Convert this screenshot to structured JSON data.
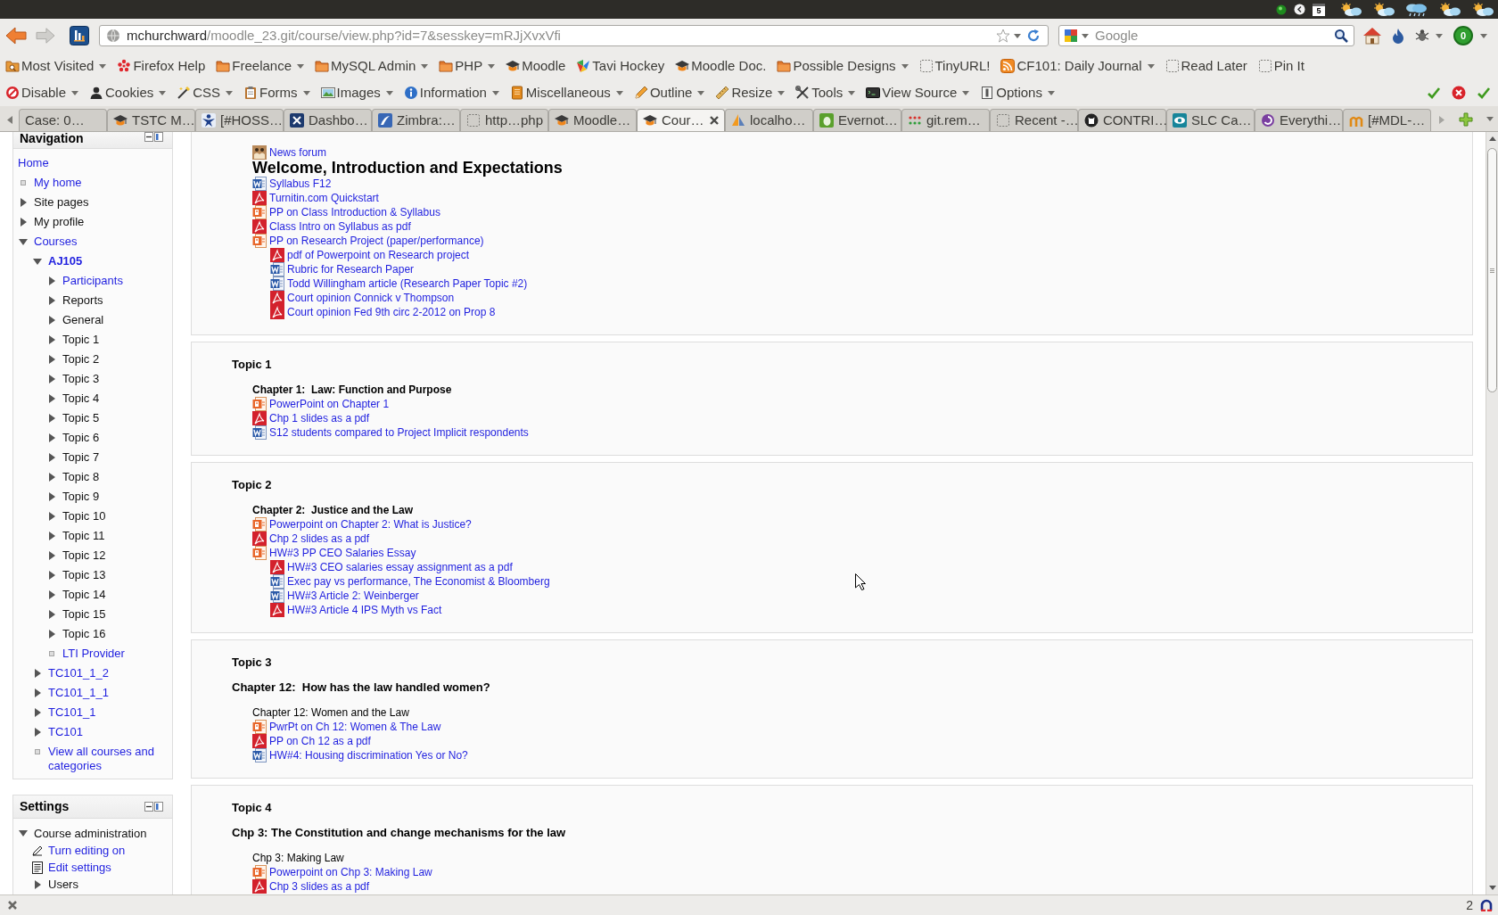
{
  "panel": {
    "calendar_day": "5"
  },
  "navbar": {
    "url_host": "mchurchward",
    "url_path": "/moodle_23.git/course/view.php?id=7&sesskey=mRJjXvxVfi",
    "search": {
      "placeholder": "Google"
    },
    "badge": "0"
  },
  "bookmarks": [
    {
      "label": "Most Visited",
      "kind": "smart",
      "menu": true
    },
    {
      "label": "Firefox Help",
      "kind": "help",
      "menu": false
    },
    {
      "label": "Freelance",
      "kind": "folder",
      "menu": true
    },
    {
      "label": "MySQL Admin",
      "kind": "folder",
      "menu": true
    },
    {
      "label": "PHP",
      "kind": "folder",
      "menu": true
    },
    {
      "label": "Moodle",
      "kind": "moodle",
      "menu": false
    },
    {
      "label": "Tavi Hockey",
      "kind": "site",
      "menu": false
    },
    {
      "label": "Moodle Doc.",
      "kind": "moodle",
      "menu": false
    },
    {
      "label": "Possible Designs",
      "kind": "folder",
      "menu": true
    },
    {
      "label": "TinyURL!",
      "kind": "page",
      "menu": false
    },
    {
      "label": "CF101: Daily Journal",
      "kind": "feed",
      "menu": true
    },
    {
      "label": "Read Later",
      "kind": "page",
      "menu": false
    },
    {
      "label": "Pin It",
      "kind": "page",
      "menu": false
    }
  ],
  "developer_toolbar": [
    "Disable",
    "Cookies",
    "CSS",
    "Forms",
    "Images",
    "Information",
    "Miscellaneous",
    "Outline",
    "Resize",
    "Tools",
    "View Source",
    "Options"
  ],
  "tabs": [
    {
      "label": "Case: 0…",
      "selected": false
    },
    {
      "label": "TSTC M…",
      "selected": false
    },
    {
      "label": "[#HOSS…",
      "selected": false
    },
    {
      "label": "Dashbo…",
      "selected": false
    },
    {
      "label": "Zimbra:…",
      "selected": false
    },
    {
      "label": "http…php",
      "selected": false
    },
    {
      "label": "Moodle…",
      "selected": false
    },
    {
      "label": "Cour…",
      "selected": true
    },
    {
      "label": "localho…",
      "selected": false
    },
    {
      "label": "Evernot…",
      "selected": false
    },
    {
      "label": "git.rem…",
      "selected": false
    },
    {
      "label": "Recent -…",
      "selected": false
    },
    {
      "label": "CONTRI…",
      "selected": false
    },
    {
      "label": "SLC Ca…",
      "selected": false
    },
    {
      "label": "Everythi…",
      "selected": false
    },
    {
      "label": "[#MDL-…",
      "selected": false
    }
  ],
  "navigation": {
    "title": "Navigation",
    "items": [
      {
        "label": "Home",
        "kind": "plain",
        "link": true,
        "selected": false
      },
      {
        "label": "My home",
        "kind": "leaf",
        "link": true,
        "selected": false
      },
      {
        "label": "Site pages",
        "kind": "branch",
        "expanded": false,
        "link": false,
        "selected": false
      },
      {
        "label": "My profile",
        "kind": "branch",
        "expanded": false,
        "link": false,
        "selected": false
      },
      {
        "label": "Courses",
        "kind": "branch",
        "expanded": true,
        "link": true,
        "selected": false,
        "children": [
          {
            "label": "AJ105",
            "kind": "branch",
            "expanded": true,
            "link": true,
            "selected": true,
            "children": [
              {
                "label": "Participants",
                "kind": "branch",
                "expanded": false,
                "link": true,
                "selected": false
              },
              {
                "label": "Reports",
                "kind": "branch",
                "expanded": false,
                "link": false,
                "selected": false
              },
              {
                "label": "General",
                "kind": "branch",
                "expanded": false,
                "link": false,
                "selected": false
              },
              {
                "label": "Topic 1",
                "kind": "branch",
                "expanded": false,
                "link": false,
                "selected": false
              },
              {
                "label": "Topic 2",
                "kind": "branch",
                "expanded": false,
                "link": false,
                "selected": false
              },
              {
                "label": "Topic 3",
                "kind": "branch",
                "expanded": false,
                "link": false,
                "selected": false
              },
              {
                "label": "Topic 4",
                "kind": "branch",
                "expanded": false,
                "link": false,
                "selected": false
              },
              {
                "label": "Topic 5",
                "kind": "branch",
                "expanded": false,
                "link": false,
                "selected": false
              },
              {
                "label": "Topic 6",
                "kind": "branch",
                "expanded": false,
                "link": false,
                "selected": false
              },
              {
                "label": "Topic 7",
                "kind": "branch",
                "expanded": false,
                "link": false,
                "selected": false
              },
              {
                "label": "Topic 8",
                "kind": "branch",
                "expanded": false,
                "link": false,
                "selected": false
              },
              {
                "label": "Topic 9",
                "kind": "branch",
                "expanded": false,
                "link": false,
                "selected": false
              },
              {
                "label": "Topic 10",
                "kind": "branch",
                "expanded": false,
                "link": false,
                "selected": false
              },
              {
                "label": "Topic 11",
                "kind": "branch",
                "expanded": false,
                "link": false,
                "selected": false
              },
              {
                "label": "Topic 12",
                "kind": "branch",
                "expanded": false,
                "link": false,
                "selected": false
              },
              {
                "label": "Topic 13",
                "kind": "branch",
                "expanded": false,
                "link": false,
                "selected": false
              },
              {
                "label": "Topic 14",
                "kind": "branch",
                "expanded": false,
                "link": false,
                "selected": false
              },
              {
                "label": "Topic 15",
                "kind": "branch",
                "expanded": false,
                "link": false,
                "selected": false
              },
              {
                "label": "Topic 16",
                "kind": "branch",
                "expanded": false,
                "link": false,
                "selected": false
              },
              {
                "label": "LTI Provider",
                "kind": "leaf",
                "link": true,
                "selected": false
              }
            ]
          },
          {
            "label": "TC101_1_2",
            "kind": "branch",
            "expanded": false,
            "link": true,
            "selected": false
          },
          {
            "label": "TC101_1_1",
            "kind": "branch",
            "expanded": false,
            "link": true,
            "selected": false
          },
          {
            "label": "TC101_1",
            "kind": "branch",
            "expanded": false,
            "link": true,
            "selected": false
          },
          {
            "label": "TC101",
            "kind": "branch",
            "expanded": false,
            "link": true,
            "selected": false
          },
          {
            "label": "View all courses and categories",
            "kind": "leaf",
            "link": true,
            "selected": false
          }
        ]
      }
    ]
  },
  "settings": {
    "title": "Settings",
    "items": [
      {
        "label": "Course administration",
        "kind": "branch",
        "expanded": true,
        "link": false,
        "selected": false,
        "children": [
          {
            "label": "Turn editing on",
            "kind": "edit",
            "link": true,
            "selected": false
          },
          {
            "label": "Edit settings",
            "kind": "settings",
            "link": true,
            "selected": false
          },
          {
            "label": "Users",
            "kind": "branch",
            "expanded": false,
            "link": false,
            "selected": false
          }
        ]
      }
    ]
  },
  "sections": [
    {
      "activities": [
        {
          "kind": "forum",
          "label": "News forum"
        },
        {
          "kind": "heading",
          "label": "Welcome, Introduction and Expectations"
        },
        {
          "kind": "word",
          "label": "Syllabus F12"
        },
        {
          "kind": "pdf",
          "label": "Turnitin.com Quickstart"
        },
        {
          "kind": "powerpoint",
          "label": "PP on Class Introduction & Syllabus"
        },
        {
          "kind": "pdf",
          "label": "Class Intro on Syllabus as pdf"
        },
        {
          "kind": "powerpoint",
          "label": "PP on Research Project (paper/performance)",
          "children": [
            {
              "kind": "pdf",
              "label": "pdf of Powerpoint on Research project"
            },
            {
              "kind": "word",
              "label": "Rubric for Research Paper"
            },
            {
              "kind": "word",
              "label": "Todd Willingham article (Research Paper Topic #2)"
            },
            {
              "kind": "pdf",
              "label": "Court opinion Connick v Thompson"
            },
            {
              "kind": "pdf",
              "label": "Court opinion Fed 9th circ 2-2012 on Prop 8"
            }
          ]
        }
      ]
    },
    {
      "title": "Topic 1",
      "activities": [
        {
          "kind": "subheading",
          "label": "Chapter 1:  Law: Function and Purpose"
        },
        {
          "kind": "powerpoint",
          "label": "PowerPoint on Chapter 1"
        },
        {
          "kind": "pdf",
          "label": "Chp 1 slides as a pdf"
        },
        {
          "kind": "word",
          "label": "S12 students compared to Project Implicit respondents"
        }
      ]
    },
    {
      "title": "Topic 2",
      "activities": [
        {
          "kind": "subheading",
          "label": "Chapter 2:  Justice and the Law"
        },
        {
          "kind": "powerpoint",
          "label": "Powerpoint on Chapter 2: What is Justice?"
        },
        {
          "kind": "pdf",
          "label": "Chp 2 slides as a pdf"
        },
        {
          "kind": "powerpoint",
          "label": "HW#3 PP CEO Salaries Essay",
          "children": [
            {
              "kind": "pdf",
              "label": "HW#3 CEO salaries essay assignment as a pdf"
            },
            {
              "kind": "word",
              "label": "Exec pay vs performance, The Economist & Bloomberg"
            },
            {
              "kind": "word",
              "label": "HW#3 Article 2: Weinberger"
            },
            {
              "kind": "pdf",
              "label": "HW#3 Article 4 IPS Myth vs Fact"
            }
          ]
        }
      ]
    },
    {
      "title": "Topic 3",
      "summary": "Chapter 12:  How has the law handled women?",
      "activities": [
        {
          "kind": "text",
          "label": "Chapter 12: Women and the Law"
        },
        {
          "kind": "powerpoint",
          "label": "PwrPt on Ch 12: Women & The Law"
        },
        {
          "kind": "pdf",
          "label": "PP on Ch 12 as a pdf"
        },
        {
          "kind": "word",
          "label": "HW#4: Housing discrimination Yes or No?"
        }
      ]
    },
    {
      "title": "Topic 4",
      "summary": "Chp 3: The Constitution and change mechanisms for the law",
      "activities": [
        {
          "kind": "text",
          "label": "Chp 3: Making Law"
        },
        {
          "kind": "powerpoint",
          "label": "Powerpoint on Chp 3: Making Law"
        },
        {
          "kind": "pdf",
          "label": "Chp 3 slides as a pdf"
        }
      ]
    }
  ],
  "status_bar": {
    "count": "2"
  }
}
